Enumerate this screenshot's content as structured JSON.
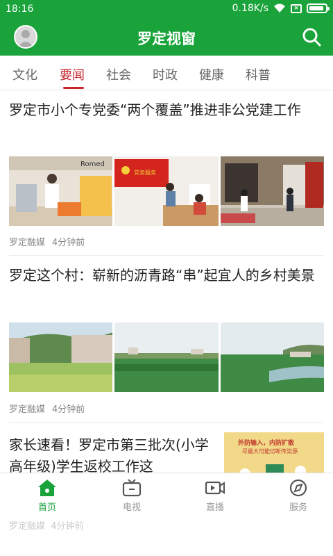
{
  "status_bar": {
    "time": "18:16",
    "speed": "0.18K/s"
  },
  "app_bar": {
    "title": "罗定视窗"
  },
  "tabs": [
    {
      "label": "文化"
    },
    {
      "label": "要闻"
    },
    {
      "label": "社会"
    },
    {
      "label": "时政"
    },
    {
      "label": "健康"
    },
    {
      "label": "科普"
    }
  ],
  "active_tab": "要闻",
  "articles": [
    {
      "title": "罗定市小个专党委“两个覆盖”推进非公党建工作",
      "source": "罗定融媒",
      "time": "4分钟前",
      "image_signs": [
        "Romed",
        "党务服务"
      ]
    },
    {
      "title": "罗定这个村：崭新的沥青路“串”起宜人的乡村美景",
      "source": "罗定融媒",
      "time": "4分钟前"
    },
    {
      "title": "家长速看！罗定市第三批次(小学高年级)学生返校工作这",
      "source": "罗定融媒",
      "time": "4分钟前",
      "image_text": "外防输入，内防扩散\n尽最大可能切断传染源"
    }
  ],
  "bottom_nav": [
    {
      "label": "首页",
      "icon": "home-icon"
    },
    {
      "label": "电视",
      "icon": "tv-icon"
    },
    {
      "label": "直播",
      "icon": "live-icon"
    },
    {
      "label": "服务",
      "icon": "compass-icon"
    }
  ],
  "colors": {
    "primary": "#19a33a",
    "accent": "#c6262e"
  }
}
